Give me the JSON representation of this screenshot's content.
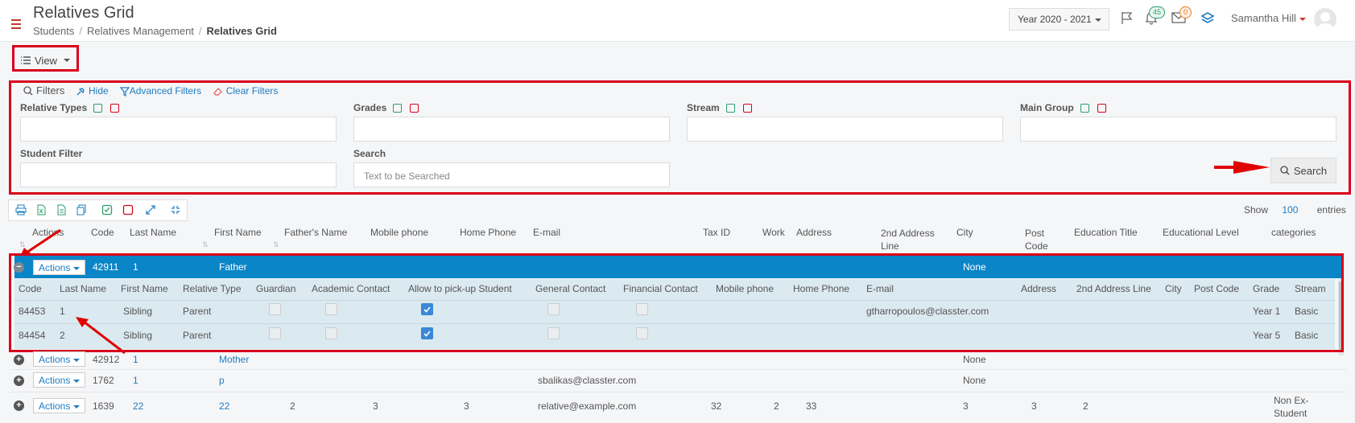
{
  "header": {
    "title": "Relatives Grid",
    "breadcrumb": [
      "Students",
      "Relatives Management",
      "Relatives Grid"
    ],
    "year": "Year 2020 - 2021",
    "notif_count": "45",
    "mail_count": "0",
    "user": "Samantha Hill"
  },
  "toolbar": {
    "view_label": "View"
  },
  "filters": {
    "title": "Filters",
    "hide": "Hide",
    "advanced": "Advanced Filters",
    "clear": "Clear Filters",
    "relative_types": "Relative Types",
    "grades": "Grades",
    "stream": "Stream",
    "main_group": "Main Group",
    "student_filter": "Student Filter",
    "search_label": "Search",
    "search_placeholder": "Text to be Searched",
    "search_button": "Search"
  },
  "grid": {
    "show_label": "Show",
    "show_value": "100",
    "entries_label": "entries",
    "columns": [
      "Actions",
      "Code",
      "Last Name",
      "First Name",
      "Father's Name",
      "Mobile phone",
      "Home Phone",
      "E-mail",
      "Tax ID",
      "Work",
      "Address",
      "2nd Address Line",
      "City",
      "Post Code",
      "Education Title",
      "Educational Level",
      "categories"
    ],
    "actions_label": "Actions",
    "rows": [
      {
        "code": "42911",
        "last": "1",
        "first": "Father",
        "email": "",
        "city": "None"
      },
      {
        "code": "42912",
        "last": "1",
        "first": "Mother",
        "email": "",
        "city": "None"
      },
      {
        "code": "1762",
        "last": "1",
        "first": "p",
        "email": "sbalikas@classter.com",
        "city": "None"
      },
      {
        "code": "1639",
        "last": "22",
        "first": "22",
        "father": "2",
        "mobile": "3",
        "home": "3",
        "email": "relative@example.com",
        "tax": "32",
        "work": "2",
        "address": "33",
        "city": "3",
        "post": "3",
        "edu_title": "2",
        "categories": "Non Ex-Student"
      }
    ]
  },
  "subgrid": {
    "columns": [
      "Code",
      "Last Name",
      "First Name",
      "Relative Type",
      "Guardian",
      "Academic Contact",
      "Allow to pick-up Student",
      "General Contact",
      "Financial Contact",
      "Mobile phone",
      "Home Phone",
      "E-mail",
      "Address",
      "2nd Address Line",
      "City",
      "Post Code",
      "Grade",
      "Stream"
    ],
    "rows": [
      {
        "code": "84453",
        "last": "1",
        "first": "Sibling",
        "type": "Parent",
        "email": "gtharropoulos@classter.com",
        "grade": "Year 1",
        "stream": "Basic"
      },
      {
        "code": "84454",
        "last": "2",
        "first": "Sibling",
        "type": "Parent",
        "email": "",
        "grade": "Year 5",
        "stream": "Basic"
      }
    ]
  }
}
